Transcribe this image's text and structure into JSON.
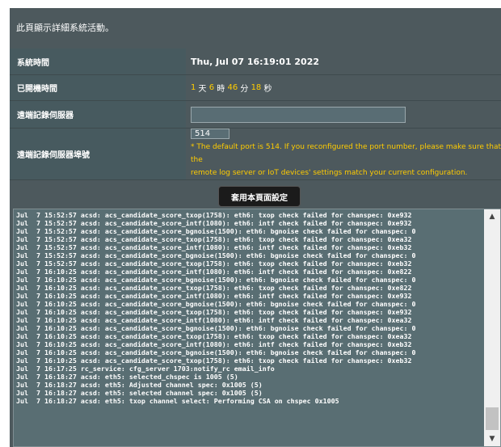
{
  "description": "此頁顯示詳細系統活動。",
  "rows": {
    "system_time": {
      "label": "系統時間",
      "value": "Thu, Jul 07 16:19:01 2022"
    },
    "uptime": {
      "label": "已開機時間",
      "days": "1",
      "days_unit": " 天 ",
      "hours": "6",
      "hours_unit": " 時 ",
      "minutes": "46",
      "minutes_unit": " 分 ",
      "seconds": "18",
      "seconds_unit": " 秒"
    },
    "remote_log_server": {
      "label": "遠端記錄伺服器",
      "value": ""
    },
    "remote_log_port": {
      "label": "遠端記錄伺服器埠號",
      "value": "514",
      "note_line1": "* The default port is 514. If you reconfigured the port number, please make sure that the",
      "note_line2": "remote log server or IoT devices' settings match your current configuration."
    }
  },
  "apply_button": "套用本頁面設定",
  "log_lines": [
    "Jul  7 15:52:57 acsd: acs_candidate_score_txop(1758): eth6: txop check failed for chanspec: 0xe932",
    "Jul  7 15:52:57 acsd: acs_candidate_score_intf(1080): eth6: intf check failed for chanspec: 0xe932",
    "Jul  7 15:52:57 acsd: acs_candidate_score_bgnoise(1500): eth6: bgnoise check failed for chanspec: 0",
    "Jul  7 15:52:57 acsd: acs_candidate_score_txop(1758): eth6: txop check failed for chanspec: 0xea32",
    "Jul  7 15:52:57 acsd: acs_candidate_score_intf(1080): eth6: intf check failed for chanspec: 0xeb32",
    "Jul  7 15:52:57 acsd: acs_candidate_score_bgnoise(1500): eth6: bgnoise check failed for chanspec: 0",
    "Jul  7 15:52:57 acsd: acs_candidate_score_txop(1758): eth6: txop check failed for chanspec: 0xeb32",
    "Jul  7 16:10:25 acsd: acs_candidate_score_intf(1080): eth6: intf check failed for chanspec: 0xe822",
    "Jul  7 16:10:25 acsd: acs_candidate_score_bgnoise(1500): eth6: bgnoise check failed for chanspec: 0",
    "Jul  7 16:10:25 acsd: acs_candidate_score_txop(1758): eth6: txop check failed for chanspec: 0xe822",
    "Jul  7 16:10:25 acsd: acs_candidate_score_intf(1080): eth6: intf check failed for chanspec: 0xe932",
    "Jul  7 16:10:25 acsd: acs_candidate_score_bgnoise(1500): eth6: bgnoise check failed for chanspec: 0",
    "Jul  7 16:10:25 acsd: acs_candidate_score_txop(1758): eth6: txop check failed for chanspec: 0xe932",
    "Jul  7 16:10:25 acsd: acs_candidate_score_intf(1080): eth6: intf check failed for chanspec: 0xea32",
    "Jul  7 16:10:25 acsd: acs_candidate_score_bgnoise(1500): eth6: bgnoise check failed for chanspec: 0",
    "Jul  7 16:10:25 acsd: acs_candidate_score_txop(1758): eth6: txop check failed for chanspec: 0xea32",
    "Jul  7 16:10:25 acsd: acs_candidate_score_intf(1080): eth6: intf check failed for chanspec: 0xeb32",
    "Jul  7 16:10:25 acsd: acs_candidate_score_bgnoise(1500): eth6: bgnoise check failed for chanspec: 0",
    "Jul  7 16:10:25 acsd: acs_candidate_score_txop(1758): eth6: txop check failed for chanspec: 0xeb32",
    "Jul  7 16:17:25 rc_service: cfg_server 1703:notify_rc email_info",
    "Jul  7 16:18:27 acsd: eth5: selected_chspec is 1005 (5)",
    "Jul  7 16:18:27 acsd: eth5: Adjusted channel spec: 0x1005 (5)",
    "Jul  7 16:18:27 acsd: eth5: selected channel spec: 0x1005 (5)",
    "Jul  7 16:18:27 acsd: eth5: txop channel select: Performing CSA on chspec 0x1005"
  ]
}
